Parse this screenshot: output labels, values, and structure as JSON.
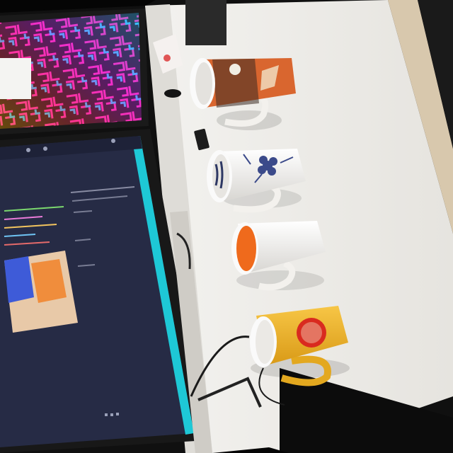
{
  "scene": {
    "mugs": [
      {
        "name": "illustrated-mug",
        "color": "#d9662f"
      },
      {
        "name": "blue-flower-mug",
        "color": "#3b4a8a"
      },
      {
        "name": "orange-lined-mug",
        "color": "#ef6a1c"
      },
      {
        "name": "yellow-logo-mug",
        "color": "#f0b428"
      }
    ],
    "colors": {
      "desk": "#ecebe8",
      "wall": "#e9e8e4",
      "monitor_bezel": "#181818",
      "code_screen": "#262b45",
      "accent_cyan": "#1ec8d6"
    }
  }
}
